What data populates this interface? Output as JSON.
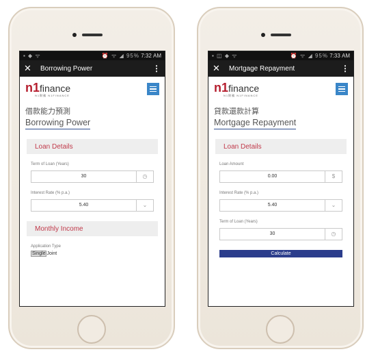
{
  "left_phone": {
    "status": {
      "icons_left": "▪ ◆ ᯤ",
      "icons_right": "⏰ ᯤ ◢ 95%",
      "time": "7:32 AM"
    },
    "appbar": {
      "close_glyph": "✕",
      "title": "Borrowing Power",
      "more_glyph": "⋮"
    },
    "brand": {
      "logo_n1": "n1",
      "logo_text": "finance",
      "logo_sub": "N1財務 N1FINANCE"
    },
    "page": {
      "zh_title": "借款能力預測",
      "en_title": "Borrowing Power"
    },
    "sections": {
      "loan_details": "Loan Details",
      "monthly_income": "Monthly Income"
    },
    "fields": {
      "term": {
        "label": "Term of Loan (Years)",
        "value": "30",
        "suffix": "◷"
      },
      "interest": {
        "label": "Interest Rate (% p.a.)",
        "value": "5.40",
        "suffix": "⌄"
      }
    },
    "application": {
      "label": "Application Type",
      "single": "Single",
      "joint": "Joint"
    }
  },
  "right_phone": {
    "status": {
      "icons_left": "▪ ◫ ◆ ᯤ",
      "icons_right": "⏰ ᯤ ◢ 95%",
      "time": "7:33 AM"
    },
    "appbar": {
      "close_glyph": "✕",
      "title": "Mortgage Repayment",
      "more_glyph": "⋮"
    },
    "brand": {
      "logo_n1": "n1",
      "logo_text": "finance",
      "logo_sub": "N1財務 N1FINANCE"
    },
    "page": {
      "zh_title": "貸款還款計算",
      "en_title": "Mortgage Repayment"
    },
    "sections": {
      "loan_details": "Loan Details"
    },
    "fields": {
      "amount": {
        "label": "Loan Amount",
        "value": "0.00",
        "suffix": "$"
      },
      "interest": {
        "label": "Interest Rate (% p.a.)",
        "value": "5.40",
        "suffix": "⌄"
      },
      "term": {
        "label": "Term of Loan (Years)",
        "value": "30",
        "suffix": "◷"
      }
    },
    "calculate_label": "Calculate"
  },
  "colors": {
    "brand_red": "#b51e2e",
    "menu_blue": "#3a86c8",
    "button_navy": "#2b3d8c",
    "section_text": "#c0394a"
  }
}
